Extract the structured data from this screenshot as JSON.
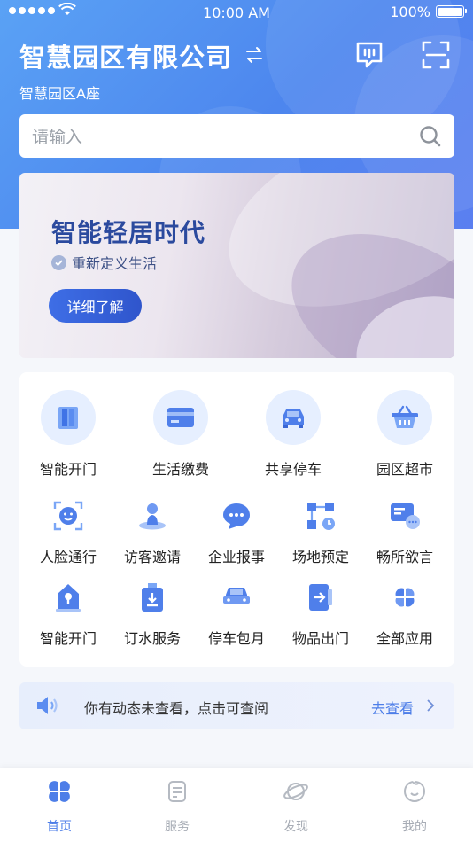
{
  "status_bar": {
    "time": "10:00 AM",
    "battery": "100%"
  },
  "header": {
    "company": "智慧园区有限公司",
    "location": "智慧园区A座"
  },
  "search": {
    "placeholder": "请输入"
  },
  "banner": {
    "title": "智能轻居时代",
    "subtitle": "重新定义生活",
    "button": "详细了解"
  },
  "services": {
    "featured": [
      {
        "label": "智能开门",
        "icon": "door-icon"
      },
      {
        "label": "生活缴费",
        "icon": "card-icon"
      },
      {
        "label": "共享停车",
        "icon": "car-icon"
      },
      {
        "label": "园区超市",
        "icon": "basket-icon"
      }
    ],
    "row2": [
      {
        "label": "人脸通行",
        "icon": "face-scan-icon"
      },
      {
        "label": "访客邀请",
        "icon": "visitor-icon"
      },
      {
        "label": "企业报事",
        "icon": "chat-icon"
      },
      {
        "label": "场地预定",
        "icon": "venue-icon"
      },
      {
        "label": "畅所欲言",
        "icon": "speak-icon"
      }
    ],
    "row3": [
      {
        "label": "智能开门",
        "icon": "smart-lock-icon"
      },
      {
        "label": "订水服务",
        "icon": "water-icon"
      },
      {
        "label": "停车包月",
        "icon": "parking-icon"
      },
      {
        "label": "物品出门",
        "icon": "exit-icon"
      },
      {
        "label": "全部应用",
        "icon": "apps-icon"
      }
    ]
  },
  "notice": {
    "message": "你有动态未查看，点击可查阅",
    "action": "去查看"
  },
  "tabbar": [
    {
      "label": "首页",
      "icon": "home-icon",
      "active": true
    },
    {
      "label": "服务",
      "icon": "service-icon",
      "active": false
    },
    {
      "label": "发现",
      "icon": "discover-icon",
      "active": false
    },
    {
      "label": "我的",
      "icon": "profile-icon",
      "active": false
    }
  ],
  "colors": {
    "accent": "#4d7ee8",
    "header": "#5a8ff2",
    "banner_title": "#2b4a9e"
  }
}
